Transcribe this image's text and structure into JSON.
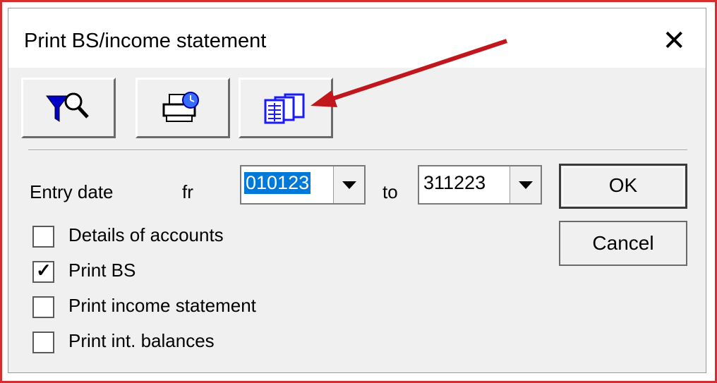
{
  "window": {
    "title": "Print BS/income statement",
    "close_glyph": "✕"
  },
  "toolbar": {
    "buttons": [
      {
        "name": "filter-search-button",
        "icon": "filter-magnifier-icon"
      },
      {
        "name": "print-schedule-button",
        "icon": "printer-clock-icon"
      },
      {
        "name": "multi-report-button",
        "icon": "stacked-reports-icon"
      }
    ]
  },
  "entry_date": {
    "label": "Entry date",
    "from_label": "fr",
    "from_value": "010123",
    "to_label": "to",
    "to_value": "311223"
  },
  "buttons": {
    "ok": "OK",
    "cancel": "Cancel"
  },
  "options": [
    {
      "label": "Details of accounts",
      "checked": false
    },
    {
      "label": "Print BS",
      "checked": true
    },
    {
      "label": "Print income statement",
      "checked": false
    },
    {
      "label": "Print int. balances",
      "checked": false
    }
  ],
  "colors": {
    "annotation_arrow": "#c0161c",
    "selection": "#0078d7",
    "icon_blue": "#1a1aff"
  }
}
